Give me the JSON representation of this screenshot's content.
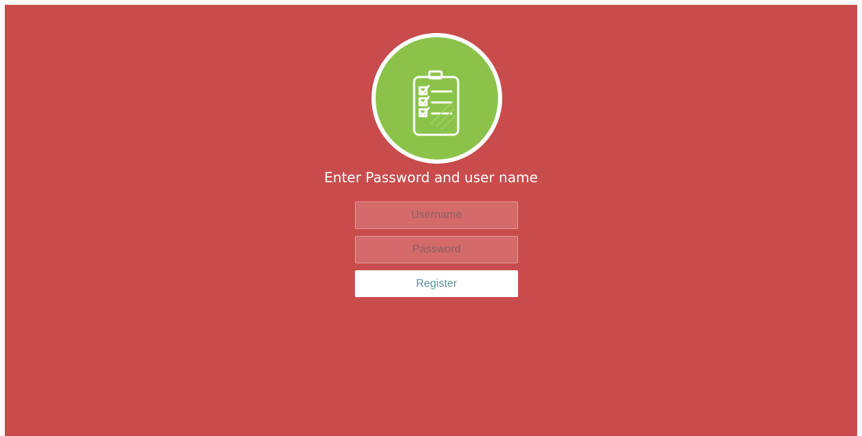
{
  "logo": {
    "icon": "clipboard-checklist-icon",
    "circle_color": "#8bc34a",
    "ring_color": "#ffffff"
  },
  "title": "Enter Password and user name",
  "form": {
    "username_placeholder": "Username",
    "password_placeholder": "Password",
    "register_label": "Register"
  },
  "colors": {
    "background": "#c94c4c",
    "field_background": "#d46a6a",
    "button_text": "#5a8f97"
  }
}
